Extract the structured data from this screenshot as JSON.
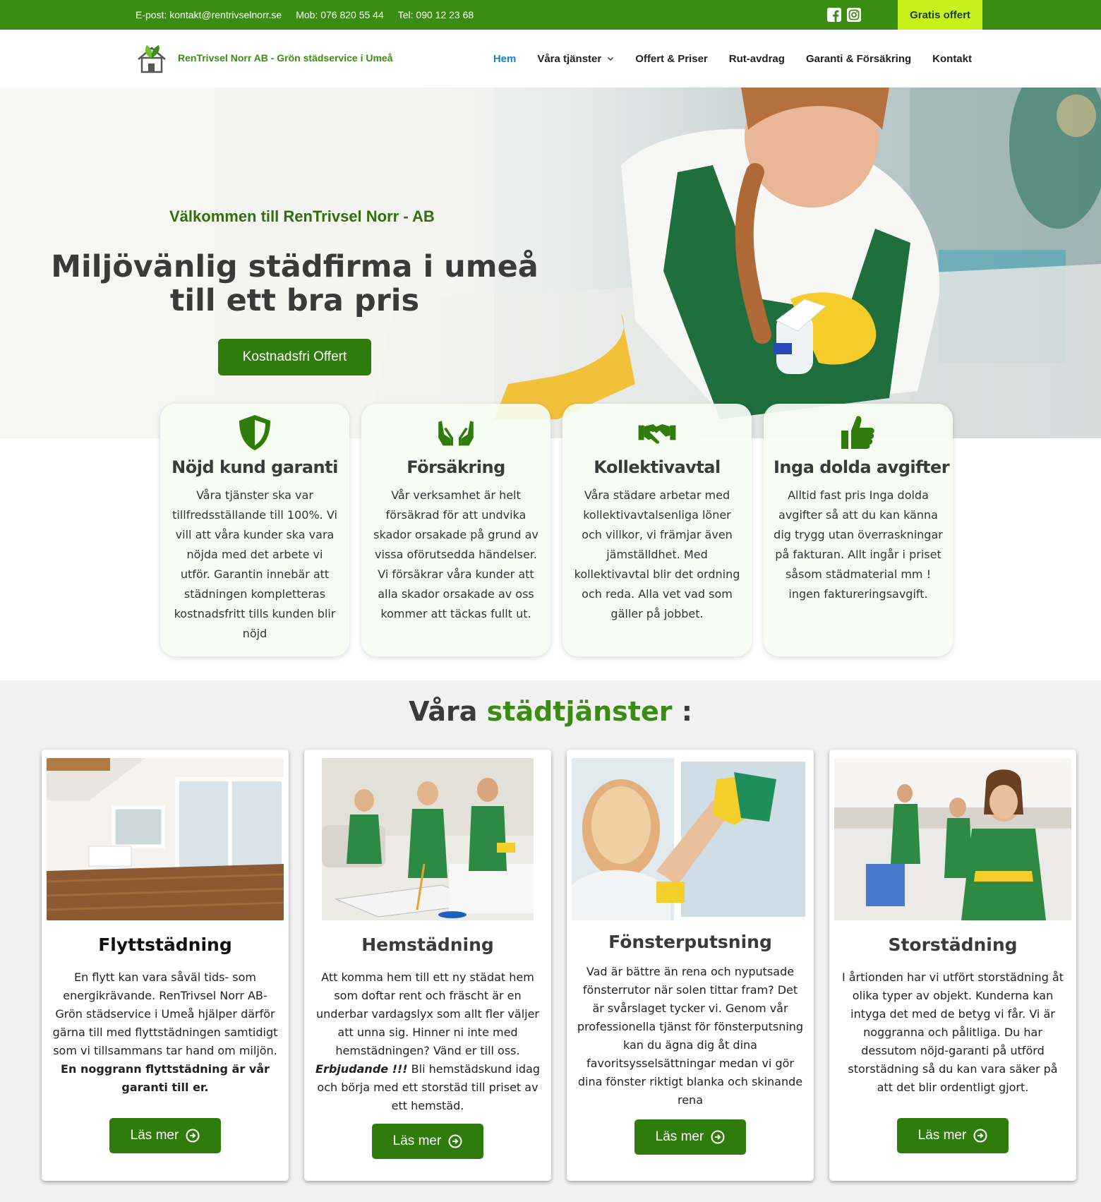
{
  "topbar": {
    "email": "E-post: kontakt@rentrivselnorr.se",
    "mobile": "Mob: 076 820 55 44",
    "phone": "Tel: 090 12 23 68",
    "socials": [
      "facebook-icon",
      "instagram-icon"
    ],
    "cta_label": "Gratis offert",
    "colors": {
      "bar": "#3a8c12",
      "cta": "#c8f21d"
    }
  },
  "header": {
    "brand_name": "RenTrivsel Norr AB - Grön städservice i Umeå",
    "nav": [
      {
        "label": "Hem",
        "active": true
      },
      {
        "label": "Våra tjänster",
        "has_dropdown": true
      },
      {
        "label": "Offert & Priser"
      },
      {
        "label": "Rut-avdrag"
      },
      {
        "label": "Garanti & Försäkring"
      },
      {
        "label": "Kontakt"
      }
    ]
  },
  "hero": {
    "welcome": "Välkommen till RenTrivsel Norr - AB",
    "headline": "Miljövänlig städfirma i umeå till ett bra pris",
    "button": "Kostnadsfri Offert"
  },
  "features": [
    {
      "icon": "shield-icon",
      "title": "Nöjd kund garanti",
      "text": "Våra tjänster ska var tillfredsställande till 100%. Vi vill att våra kunder ska vara nöjda med det arbete vi utför. Garantin innebär att städningen kompletteras kostnadsfritt tills kunden blir nöjd"
    },
    {
      "icon": "hands-icon",
      "title": "Försäkring",
      "text": "Vår verksamhet är helt försäkrad för att undvika skador orsakade på grund av vissa oförutsedda händelser. Vi försäkrar våra kunder att alla skador orsakade av oss kommer att täckas fullt ut."
    },
    {
      "icon": "handshake-icon",
      "title": "Kollektivavtal",
      "text": "Våra städare arbetar med kollektivavtalsenliga löner och villkor, vi främjar även jämställdhet. Med kollektivavtal blir det ordning och reda. Alla vet vad som gäller på jobbet."
    },
    {
      "icon": "thumbs-up-icon",
      "title": "Inga dolda avgifter",
      "text": "Alltid fast pris Inga dolda avgifter så att du kan känna dig trygg utan överraskningar på fakturan. Allt ingår i priset såsom städmaterial mm ! ingen faktureringsavgift."
    }
  ],
  "services": {
    "title_prefix": "Våra ",
    "title_highlight": "städtjänster",
    "title_suffix": " :",
    "cards": [
      {
        "title": "Flyttstädning",
        "text": "En flytt kan vara såväl tids- som energikrävande. RenTrivsel Norr AB- Grön städservice i Umeå hjälper därför gärna till med flyttstädningen samtidigt som vi tillsammans tar hand om miljön. ",
        "bold": "En noggrann flyttstädning är vår garanti till er.",
        "button": "Läs mer"
      },
      {
        "title": "Hemstädning",
        "text_before": "Att komma hem till ett ny städat hem som doftar rent och fräscht är en underbar vardagslyx som allt fler väljer att unna sig. Hinner ni inte med hemstädningen? Vänd er till oss. ",
        "emph": "Erbjudande !!!",
        "text_after": " Bli hemstädskund idag och börja med ett storstäd till priset av ett hemstäd.",
        "button": "Läs mer"
      },
      {
        "title": "Fönsterputsning",
        "text": "Vad är bättre än rena och nyputsade fönsterrutor när solen tittar fram? Det är svårslaget tycker vi. Genom vår professionella tjänst för fönsterputsning kan du ägna dig åt dina favoritsysselsättningar medan vi gör dina fönster riktigt blanka och skinande rena",
        "button": "Läs mer"
      },
      {
        "title": "Storstädning",
        "text": "I årtionden har vi utfört storstädning åt olika typer av objekt. Kunderna kan intyga det med de betyg vi får. Vi är noggranna och pålitliga. Du har dessutom nöjd-garanti på utförd storstädning så du kan vara säker på att det blir ordentligt gjort.",
        "button": "Läs mer"
      }
    ]
  },
  "colors": {
    "primary_green": "#2f7b0b",
    "brand_green": "#3a8c12",
    "nav_active": "#1a7fd1"
  }
}
